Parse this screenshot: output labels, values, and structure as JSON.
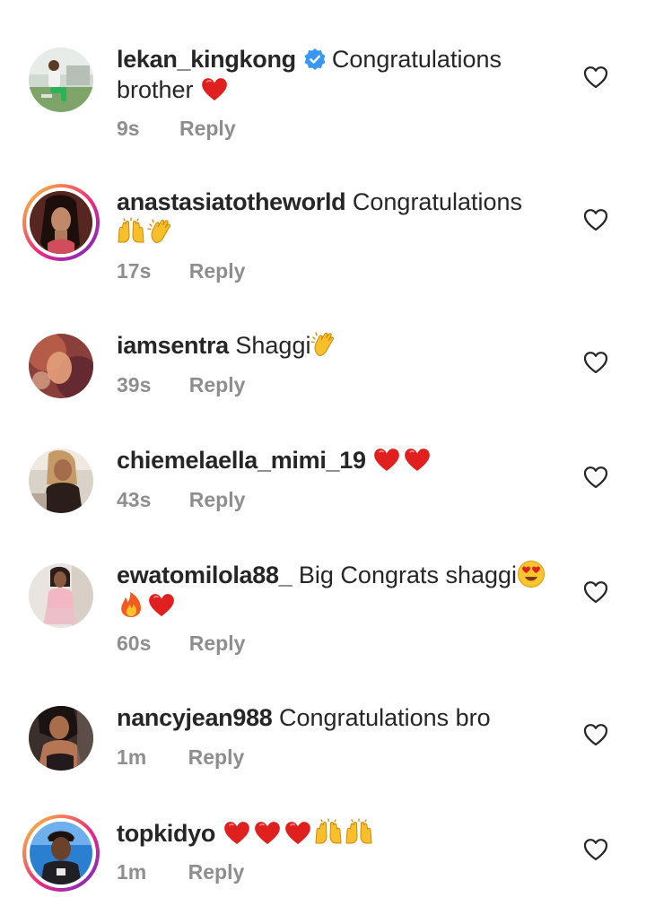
{
  "comments": [
    {
      "username": "lekan_kingkong",
      "verified": true,
      "text": "Congratulations brother",
      "emojis": [
        "heart"
      ],
      "time": "9s",
      "reply": "Reply"
    },
    {
      "username": "anastasiatotheworld",
      "verified": false,
      "text": "Congratulations",
      "emojis": [
        "raising-hands",
        "clapping-hands"
      ],
      "time": "17s",
      "reply": "Reply"
    },
    {
      "username": "iamsentra",
      "verified": false,
      "text": "Shaggi",
      "emojis": [
        "clapping-hands"
      ],
      "time": "39s",
      "reply": "Reply"
    },
    {
      "username": "chiemelaella_mimi_19",
      "verified": false,
      "text": "",
      "emojis": [
        "heart",
        "heart"
      ],
      "time": "43s",
      "reply": "Reply"
    },
    {
      "username": "ewatomilola88_",
      "verified": false,
      "text": "Big Congrats shaggi",
      "emojis": [
        "heart-eyes",
        "fire",
        "heart"
      ],
      "time": "60s",
      "reply": "Reply"
    },
    {
      "username": "nancyjean988",
      "verified": false,
      "text": "Congratulations bro",
      "emojis": [],
      "time": "1m",
      "reply": "Reply"
    },
    {
      "username": "topkidyo",
      "verified": false,
      "text": "",
      "emojis": [
        "heart",
        "heart",
        "heart",
        "raising-hands",
        "raising-hands"
      ],
      "time": "1m",
      "reply": "Reply"
    }
  ],
  "colors": {
    "text": "#262626",
    "meta": "#8e8e8e",
    "verified": "#3897f0",
    "heart": "#e0201f",
    "story_ring_start": "#f9ce34",
    "story_ring_end": "#6228d7"
  }
}
